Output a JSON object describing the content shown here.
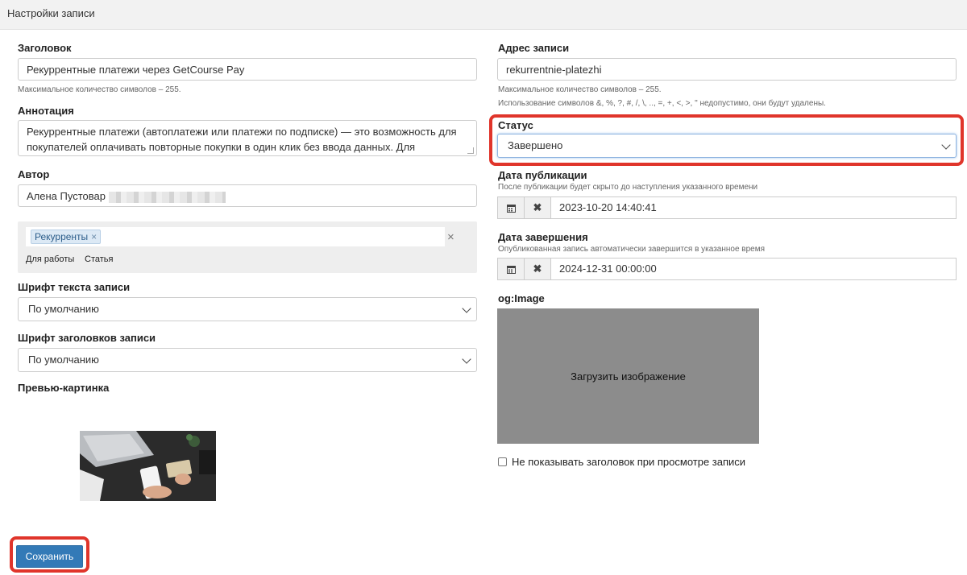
{
  "header": {
    "title": "Настройки записи"
  },
  "left": {
    "title_label": "Заголовок",
    "title_value": "Рекуррентные платежи через GetCourse Pay",
    "title_hint": "Максимальное количество символов – 255.",
    "annotation_label": "Аннотация",
    "annotation_value": "Рекуррентные платежи (автоплатежи или платежи по подписке) — это возможность для покупателей оплачивать повторные покупки в один клик без ввода данных. Для подключения",
    "author_label": "Автор",
    "author_value": "Алена Пустовар",
    "tags": [
      "Рекурренты"
    ],
    "tag_remove": "×",
    "tags_clear": "×",
    "suggestions": [
      "Для работы",
      "Статья"
    ],
    "font_text_label": "Шрифт текста записи",
    "font_text_value": "По умолчанию",
    "font_headers_label": "Шрифт заголовков записи",
    "font_headers_value": "По умолчанию",
    "preview_label": "Превью-картинка",
    "save_label": "Сохранить"
  },
  "right": {
    "address_label": "Адрес записи",
    "address_value": "rekurrentnie-platezhi",
    "address_hint1": "Максимальное количество символов – 255.",
    "address_hint2": "Использование символов &, %, ?, #, /, \\, .., =, +, <, >, \" недопустимо, они будут удалены.",
    "status_label": "Статус",
    "status_value": "Завершено",
    "pub_label": "Дата публикации",
    "pub_hint": "После публикации будет скрыто до наступления указанного времени",
    "pub_value": "2023-10-20 14:40:41",
    "end_label": "Дата завершения",
    "end_hint": "Опубликованная запись автоматически завершится в указанное время",
    "end_value": "2024-12-31 00:00:00",
    "og_label": "og:Image",
    "upload_label": "Загрузить изображение",
    "hide_title_label": "Не показывать заголовок при просмотре записи",
    "hide_title_checked": false
  },
  "colors": {
    "primary": "#337ab7",
    "highlight": "#e0352b",
    "upload_bg": "#8c8c8c"
  }
}
